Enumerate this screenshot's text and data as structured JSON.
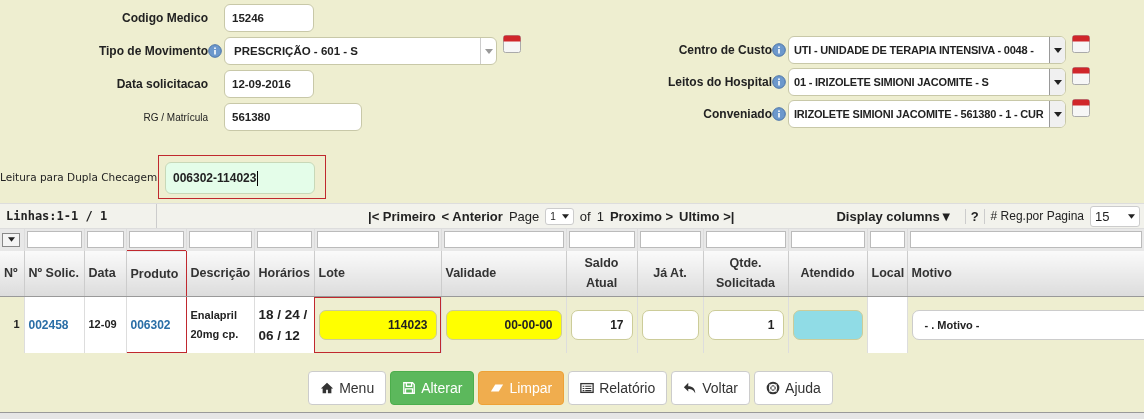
{
  "form_left": [
    {
      "label": "Codigo Medico",
      "kind": "input",
      "value": "15246",
      "info": false,
      "plain_label": false
    },
    {
      "label": "Tipo de Movimento",
      "kind": "select",
      "value": "PRESCRIÇÃO - 601 - S",
      "info": true,
      "plain_label": false
    },
    {
      "label": "Data solicitacao",
      "kind": "input",
      "value": "12-09-2016",
      "info": false,
      "plain_label": false
    },
    {
      "label": "RG / Matrícula",
      "kind": "input",
      "value": "561380",
      "info": false,
      "plain_label": true
    }
  ],
  "form_right": [
    {
      "label": "Centro de Custo",
      "kind": "select",
      "value": "UTI - UNIDADE DE TERAPIA INTENSIVA - 0048 -",
      "info": true
    },
    {
      "label": "Leitos do Hospital",
      "kind": "select",
      "value": "01 - IRIZOLETE SIMIONI JACOMITE - S",
      "info": true
    },
    {
      "label": "Conveniado",
      "kind": "select",
      "value": "IRIZOLETE SIMIONI JACOMITE - 561380 - 1 - CUR",
      "info": true
    }
  ],
  "scan": {
    "label": "Leitura para Dupla Checagem",
    "value": "006302-114023",
    "highlighted": true
  },
  "pager": {
    "rows": "Linhas:1-1 / 1",
    "first": "|< Primeiro",
    "prev": "< Anterior",
    "page_label": "Page",
    "page": "1",
    "of": "of",
    "total": "1",
    "next": "Proximo >",
    "last": "Ultimo >|",
    "display_columns": "Display columns▼",
    "help": "?",
    "per_page_label": "# Reg.por Pagina",
    "per_page": "15"
  },
  "table": {
    "columns": [
      {
        "label": "Nº",
        "highlighted": false
      },
      {
        "label": "Nº Solic.",
        "highlighted": false
      },
      {
        "label": "Data",
        "highlighted": false
      },
      {
        "label": "Produto",
        "highlighted": true
      },
      {
        "label": "Descrição",
        "highlighted": false
      },
      {
        "label": "Horários",
        "highlighted": false
      },
      {
        "label": "Lote",
        "highlighted": false
      },
      {
        "label": "Validade",
        "highlighted": false
      },
      {
        "label": "Saldo Atual",
        "highlighted": false
      },
      {
        "label": "Já At.",
        "highlighted": false
      },
      {
        "label": "Qtde. Solicitada",
        "highlighted": false
      },
      {
        "label": "Atendido",
        "highlighted": false
      },
      {
        "label": "Local",
        "highlighted": false
      },
      {
        "label": "Motivo",
        "highlighted": false
      }
    ],
    "rows": [
      {
        "cells": [
          {
            "kind": "text",
            "text": "1",
            "highlighted": false
          },
          {
            "kind": "link",
            "text": "002458",
            "highlighted": false
          },
          {
            "kind": "text",
            "text": "12-09",
            "highlighted": false
          },
          {
            "kind": "link",
            "text": "006302",
            "highlighted": true
          },
          {
            "kind": "text",
            "text": "Enalapril 20mg cp.",
            "highlighted": false
          },
          {
            "kind": "text",
            "text": "18 / 24 / 06 / 12",
            "highlighted": false
          },
          {
            "kind": "input",
            "text": "114023",
            "color": "#ffff00",
            "highlighted": true
          },
          {
            "kind": "input",
            "text": "00-00-00",
            "color": "#ffff00",
            "highlighted": false
          },
          {
            "kind": "input",
            "text": "17",
            "color": "#ffffff",
            "highlighted": false
          },
          {
            "kind": "input",
            "text": "",
            "color": "#ffffff",
            "highlighted": false
          },
          {
            "kind": "input",
            "text": "1",
            "color": "#ffffff",
            "highlighted": false
          },
          {
            "kind": "input",
            "text": "",
            "color": "#90dce6",
            "highlighted": false
          },
          {
            "kind": "blank",
            "highlighted": false
          },
          {
            "kind": "select",
            "text": "- . Motivo -",
            "highlighted": false
          }
        ]
      }
    ]
  },
  "buttons": [
    {
      "label": "Menu",
      "kind": "default"
    },
    {
      "label": "Alterar",
      "kind": "success"
    },
    {
      "label": "Limpar",
      "kind": "warning"
    },
    {
      "label": "Relatório",
      "kind": "default"
    },
    {
      "label": "Voltar",
      "kind": "default"
    },
    {
      "label": "Ajuda",
      "kind": "default"
    }
  ]
}
